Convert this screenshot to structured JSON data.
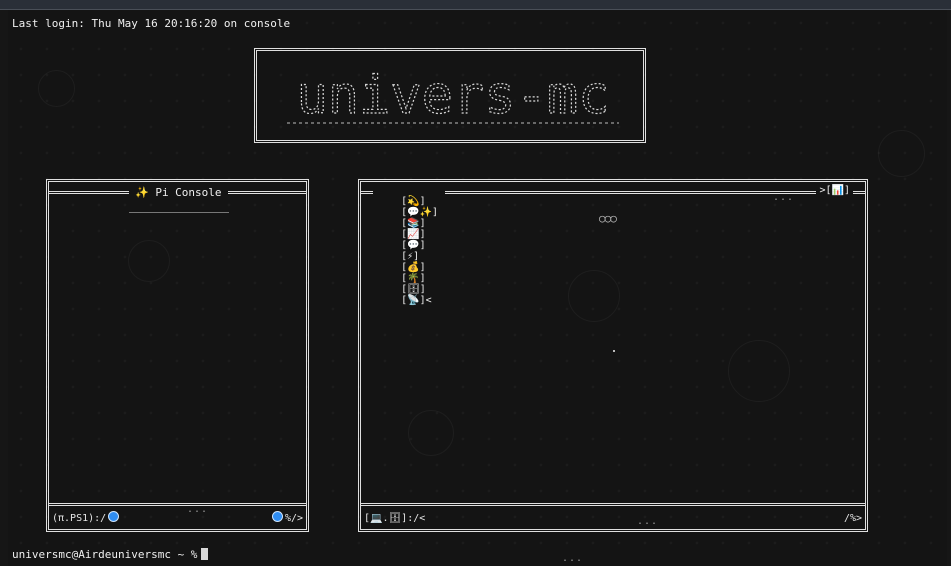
{
  "terminal": {
    "last_login": "Last login: Thu May 16 20:16:20 on console",
    "prompt": "universmc@Airdeuniversmc ~ %",
    "bottom_dots": "..."
  },
  "banner": {
    "ascii_title": "univers-mc"
  },
  "left_panel": {
    "title": "✨ Pi Console",
    "footer_left": "(π.PS1):/",
    "footer_right": "%/>",
    "footer_dots": "..."
  },
  "right_panel": {
    "tabs": [
      "[💫]",
      "[💬✨]",
      "[📚]",
      "[📈]",
      "[💬]",
      "[⚡]",
      "[💰]",
      "[🌴]",
      "[🗄]",
      "[📡]<"
    ],
    "tabs_dots": "...",
    "tab_right": ">[📊]",
    "circles": "○○○",
    "footer_left": "[💻.🗄]:/<",
    "footer_right": "/%>",
    "footer_dots": "..."
  },
  "colors": {
    "background": "#141414",
    "border": "#e0e0e0",
    "dot": "#2f8df2"
  }
}
